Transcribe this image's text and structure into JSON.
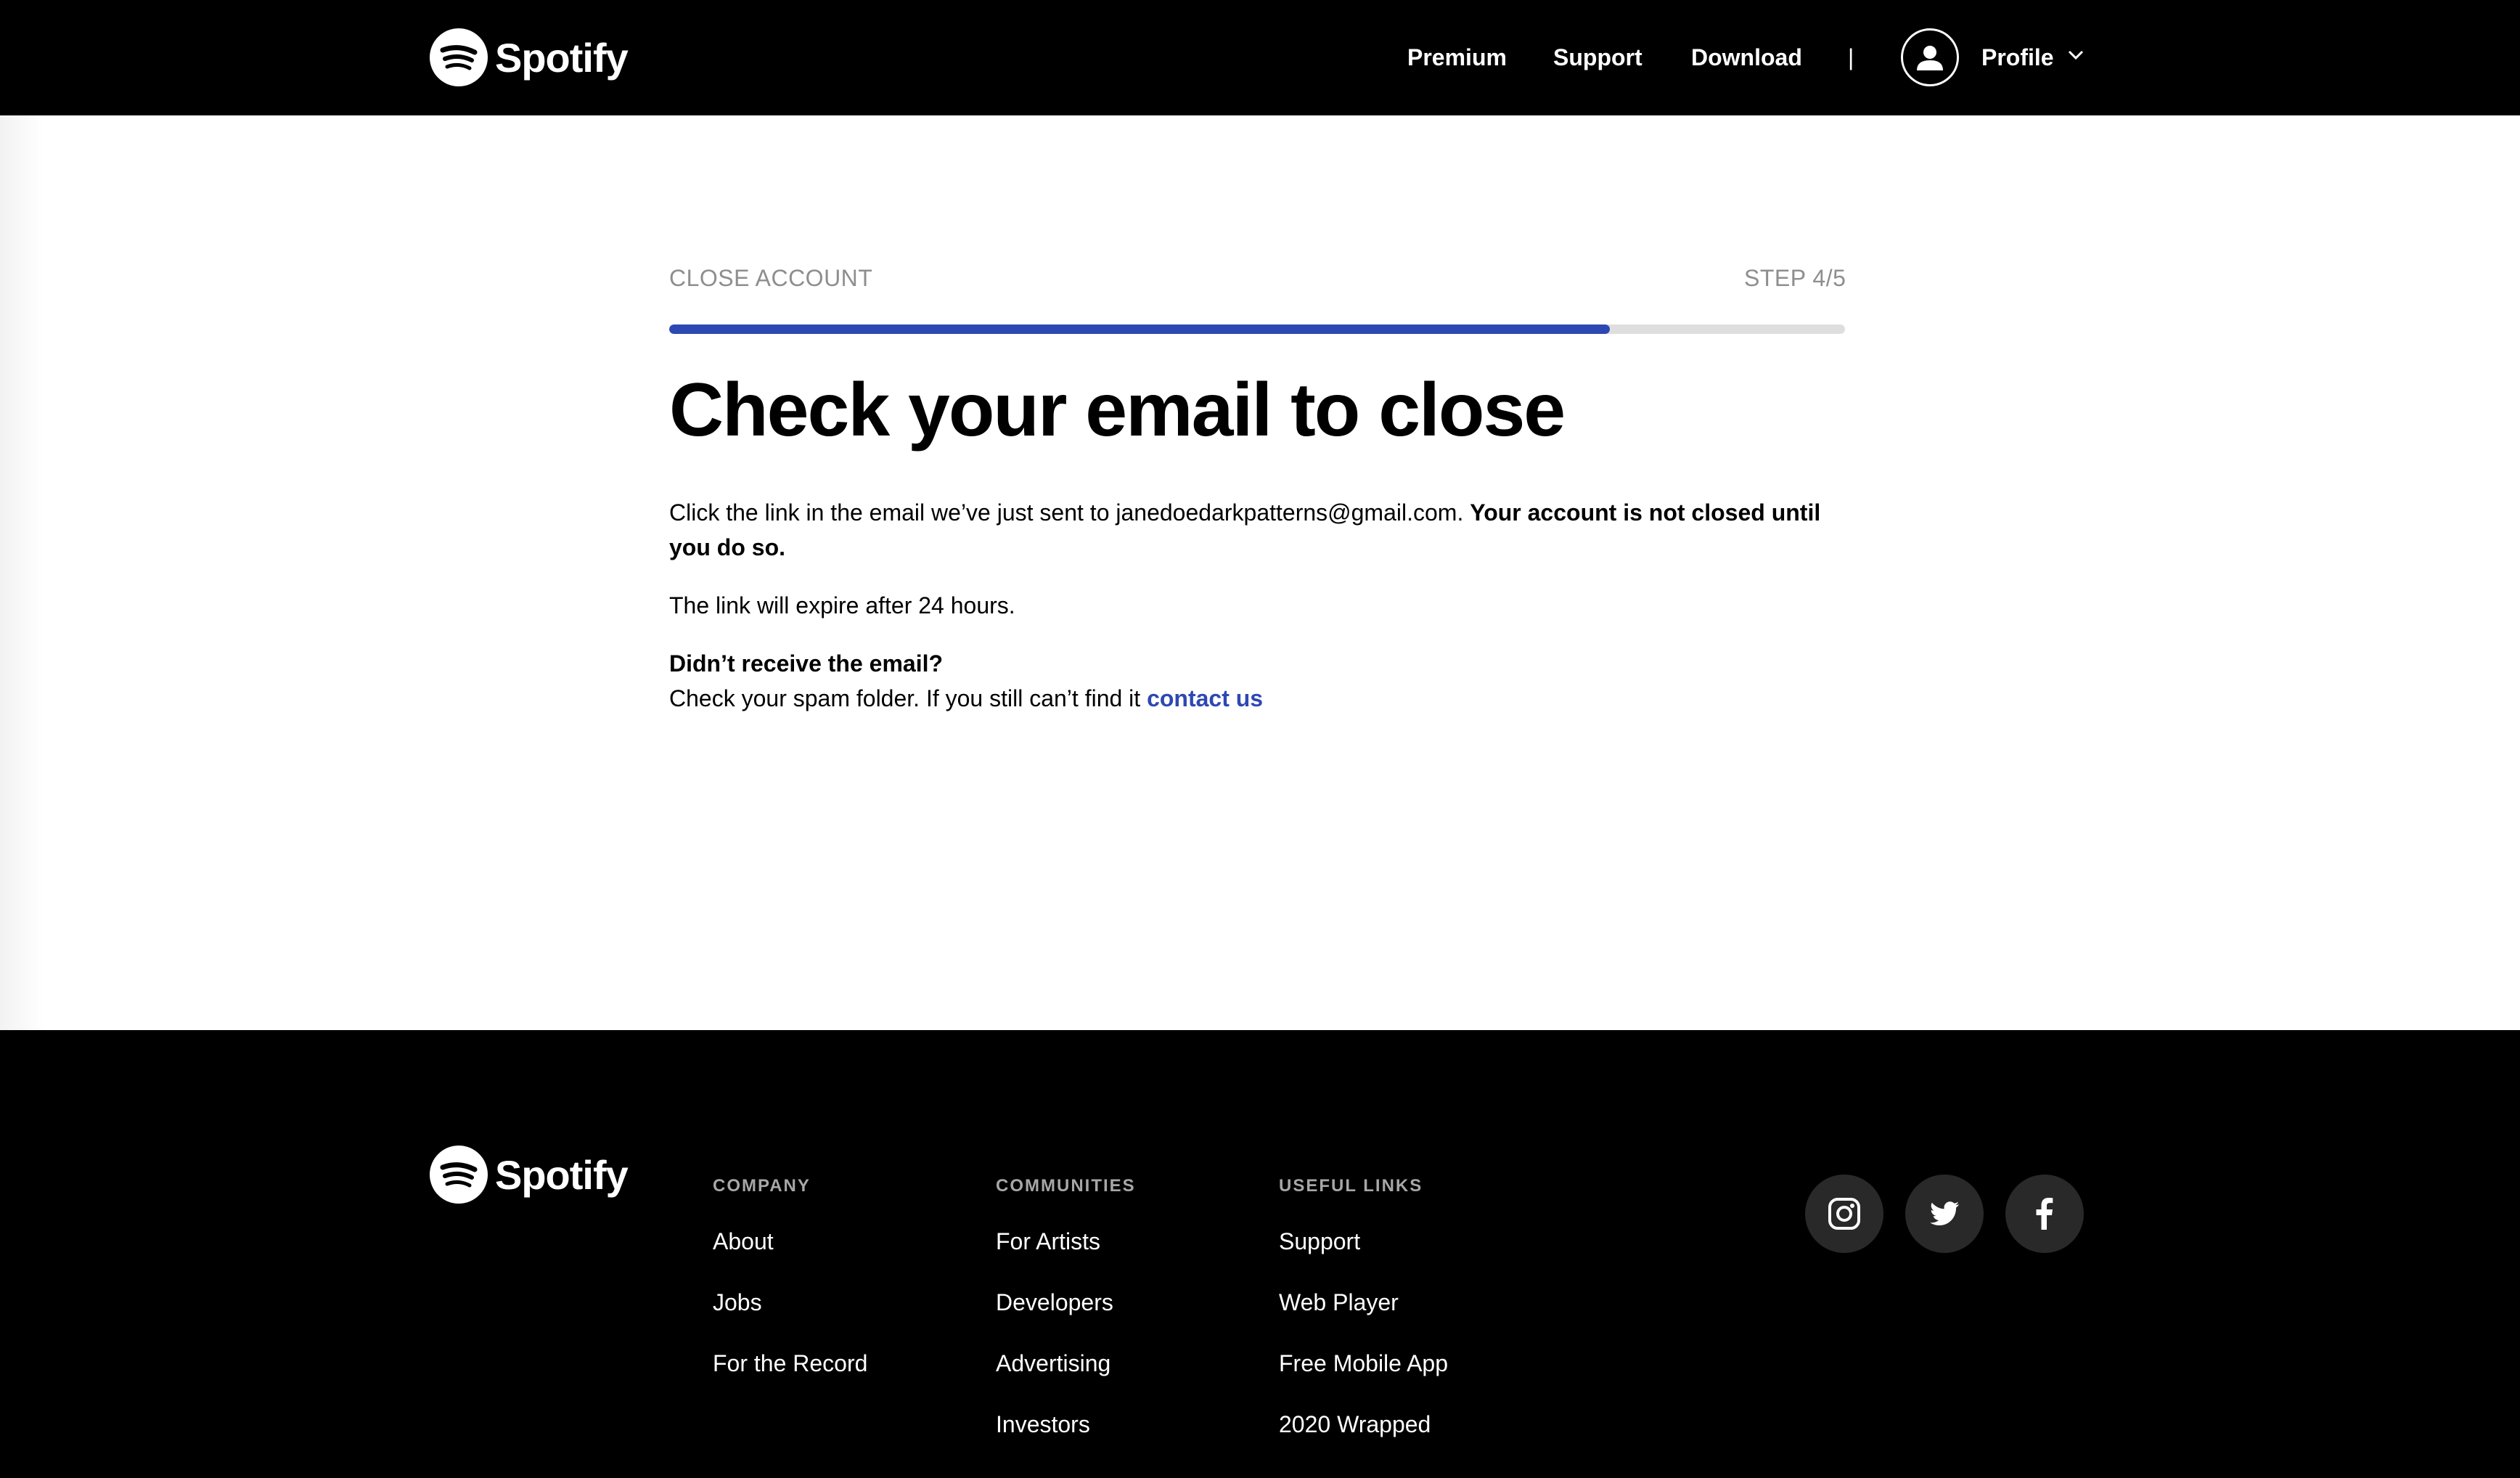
{
  "header": {
    "brand": "Spotify",
    "nav": {
      "premium": "Premium",
      "support": "Support",
      "download": "Download",
      "separator": "|",
      "profile": "Profile"
    }
  },
  "flow": {
    "label": "CLOSE ACCOUNT",
    "step": "STEP 4/5",
    "progress_fraction": 0.8
  },
  "main": {
    "title": "Check your email to close",
    "p1_text": "Click the link in the email we’ve just sent to janedoedarkpatterns@gmail.com. ",
    "p1_bold": "Your account is not closed until you do so.",
    "p2": "The link will expire after 24 hours.",
    "p3_heading": "Didn’t receive the email?",
    "p3_text": "Check your spam folder. If you still can’t find it ",
    "p3_link": "contact us"
  },
  "footer": {
    "brand": "Spotify",
    "columns": [
      {
        "heading": "COMPANY",
        "links": [
          "About",
          "Jobs",
          "For the Record"
        ]
      },
      {
        "heading": "COMMUNITIES",
        "links": [
          "For Artists",
          "Developers",
          "Advertising",
          "Investors"
        ]
      },
      {
        "heading": "USEFUL LINKS",
        "links": [
          "Support",
          "Web Player",
          "Free Mobile App",
          "2020 Wrapped"
        ]
      }
    ],
    "social": [
      "instagram-icon",
      "twitter-icon",
      "facebook-icon"
    ]
  },
  "colors": {
    "accent": "#2e48b3",
    "header_bg": "#000000",
    "muted_text": "#8e8e8e",
    "progress_track": "#dedede"
  }
}
